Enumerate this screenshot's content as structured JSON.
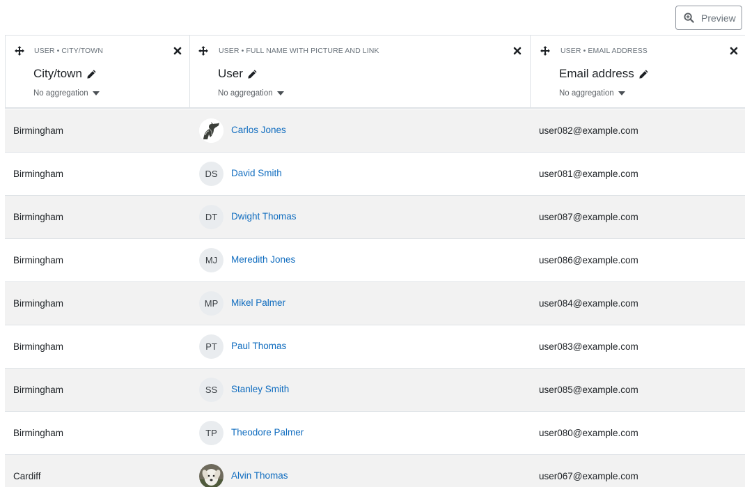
{
  "toolbar": {
    "preview_label": "Preview",
    "preview_icon": "zoom-in-icon"
  },
  "columns": [
    {
      "source": "USER • CITY/TOWN",
      "title": "City/town",
      "aggregation": "No aggregation"
    },
    {
      "source": "USER • FULL NAME WITH PICTURE AND LINK",
      "title": "User",
      "aggregation": "No aggregation"
    },
    {
      "source": "USER • EMAIL ADDRESS",
      "title": "Email address",
      "aggregation": "No aggregation"
    }
  ],
  "rows": [
    {
      "city": "Birmingham",
      "initials": "",
      "picture": "bull-photo",
      "name": "Carlos Jones",
      "email": "user082@example.com"
    },
    {
      "city": "Birmingham",
      "initials": "DS",
      "name": "David Smith",
      "email": "user081@example.com"
    },
    {
      "city": "Birmingham",
      "initials": "DT",
      "name": "Dwight Thomas",
      "email": "user087@example.com"
    },
    {
      "city": "Birmingham",
      "initials": "MJ",
      "name": "Meredith Jones",
      "email": "user086@example.com"
    },
    {
      "city": "Birmingham",
      "initials": "MP",
      "name": "Mikel Palmer",
      "email": "user084@example.com"
    },
    {
      "city": "Birmingham",
      "initials": "PT",
      "name": "Paul Thomas",
      "email": "user083@example.com"
    },
    {
      "city": "Birmingham",
      "initials": "SS",
      "name": "Stanley Smith",
      "email": "user085@example.com"
    },
    {
      "city": "Birmingham",
      "initials": "TP",
      "name": "Theodore Palmer",
      "email": "user080@example.com"
    },
    {
      "city": "Cardiff",
      "initials": "",
      "picture": "dog-photo",
      "name": "Alvin Thomas",
      "email": "user067@example.com"
    }
  ],
  "colors": {
    "link": "#0f6cbf",
    "stripe": "#f2f2f2",
    "border": "#dee2e6",
    "avatar_bg": "#e9ecef"
  }
}
